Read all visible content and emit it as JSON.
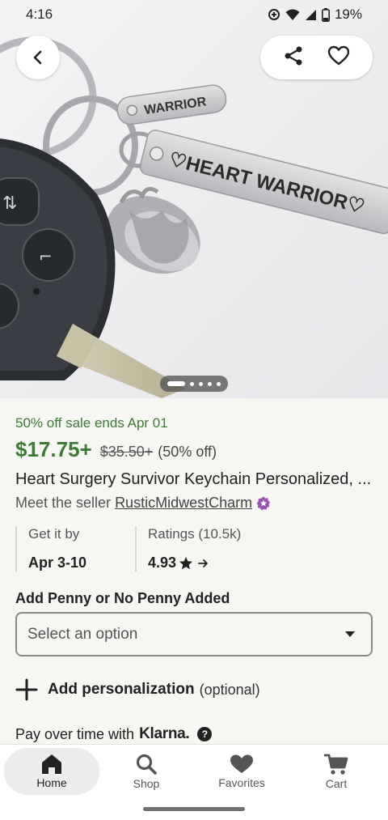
{
  "status_bar": {
    "time": "4:16",
    "battery": "19%"
  },
  "carousel": {
    "total": 5,
    "active_index": 0
  },
  "product": {
    "sale_text": "50% off sale ends Apr 01",
    "price": "$17.75+",
    "original_price": "$35.50+",
    "discount": "(50% off)",
    "title": "Heart Surgery Survivor Keychain Personalized, ...",
    "seller_prefix": "Meet the seller",
    "seller_name": "RusticMidwestCharm"
  },
  "delivery": {
    "label": "Get it by",
    "value": "Apr 3-10"
  },
  "ratings": {
    "label": "Ratings (10.5k)",
    "value": "4.93"
  },
  "variation": {
    "label": "Add Penny or No Penny Added",
    "placeholder": "Select an option"
  },
  "personalization": {
    "label": "Add personalization",
    "optional": "(optional)"
  },
  "klarna": {
    "prefix": "Pay over time with",
    "brand": "Klarna."
  },
  "nav": [
    {
      "label": "Home",
      "icon": "home-icon"
    },
    {
      "label": "Shop",
      "icon": "search-icon"
    },
    {
      "label": "Favorites",
      "icon": "heart-icon"
    },
    {
      "label": "Cart",
      "icon": "cart-icon"
    }
  ],
  "colors": {
    "sale_green": "#3d7a34",
    "background": "#f6f6f3"
  }
}
